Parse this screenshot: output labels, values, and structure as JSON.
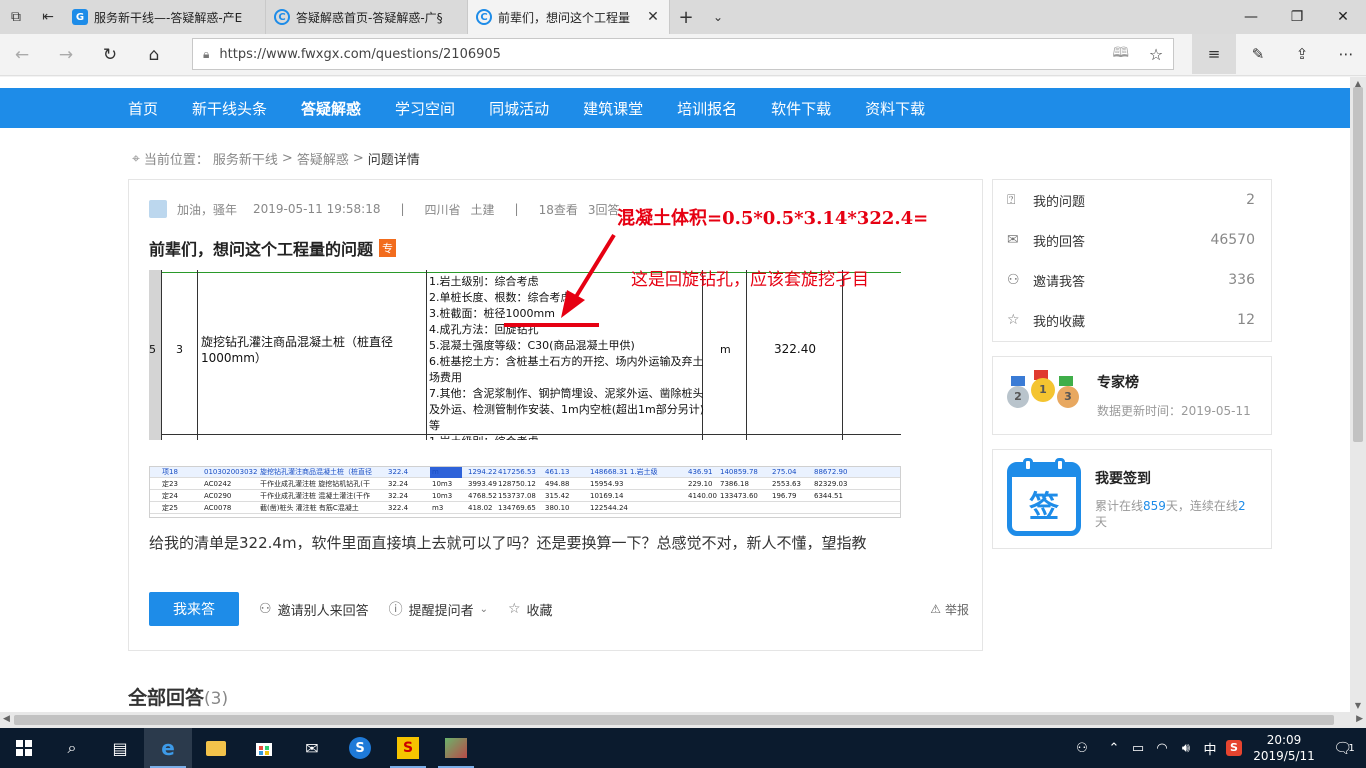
{
  "browser": {
    "tabs": [
      {
        "title": "服务新干线—-答疑解惑-产E",
        "active": false
      },
      {
        "title": "答疑解惑首页-答疑解惑-广§",
        "active": false
      },
      {
        "title": "前辈们，想问这个工程量",
        "active": true
      }
    ],
    "url": "https://www.fwxgx.com/questions/2106905"
  },
  "site_nav": [
    "首页",
    "新干线头条",
    "答疑解惑",
    "学习空间",
    "同城活动",
    "建筑课堂",
    "培训报名",
    "软件下载",
    "资料下载"
  ],
  "site_nav_current": "答疑解惑",
  "breadcrumb": {
    "prefix": "当前位置：",
    "l1": "服务新干线",
    "sep": ">",
    "l2": "答疑解惑",
    "l3": "问题详情"
  },
  "question": {
    "author": "加油，骚年",
    "date": "2019-05-11 19:58:18",
    "sep": "|",
    "region": "四川省",
    "major": "土建",
    "views": "18查看",
    "answers": "3回答",
    "title": "前辈们，想问这个工程量的问题",
    "tag": "专",
    "body": "给我的清单是322.4m，软件里面直接填上去就可以了吗？还是要换算一下？总感觉不对，新人不懂，望指教"
  },
  "annotations": {
    "line1": "混凝土体积=0.5*0.5*3.14*322.4=",
    "line2": "这是回旋钻孔，应该套旋挖孑目"
  },
  "table_image": {
    "left_num": "5",
    "seq": "3",
    "name": "旋挖钻孔灌注商品混凝土桩（桩直径1000mm）",
    "spec": "1.岩土级别：综合考虑\n2.单桩长度、根数：综合考虑\n3.桩截面：桩径1000mm\n4.成孔方法：回旋钻孔\n5.混凝土强度等级：C30(商品混凝土甲供)\n6.桩基挖土方：含桩基土石方的开挖、场内外运输及弃土场费用\n7.其他：含泥浆制作、钢护筒埋设、泥浆外运、凿除桩头及外运、检测管制作安装、1m内空桩(超出1m部分另计)等\n1.岩土级别：综合考虑",
    "unit": "m",
    "qty": "322.40"
  },
  "software_image": {
    "rows": [
      [
        "项18",
        "010302003032",
        "旋挖钻孔灌注商品混凝土桩（桩直径",
        "322.4",
        "m",
        "1294.22",
        "417256.53",
        "461.13",
        "148668.31",
        "1.岩土级",
        "436.91",
        "140859.78",
        "275.04",
        "88672.90"
      ],
      [
        "定23",
        "AC0242",
        "干作业成孔灌注桩 旋挖钻机钻孔(干",
        "32.24",
        "10m3",
        "3993.49",
        "128750.12",
        "494.88",
        "15954.93",
        "",
        "229.10",
        "7386.18",
        "2553.63",
        "82329.03"
      ],
      [
        "定24",
        "AC0290",
        "干作业成孔灌注桩 混凝土灌注(干作",
        "32.24",
        "10m3",
        "4768.52",
        "153737.08",
        "315.42",
        "10169.14",
        "",
        "4140.00",
        "133473.60",
        "196.79",
        "6344.51"
      ],
      [
        "定25",
        "AC0078",
        "截(凿)桩头 灌注桩 有筋C混凝土",
        "322.4",
        "m3",
        "418.02",
        "134769.65",
        "380.10",
        "122544.24",
        "",
        "",
        "",
        "",
        ""
      ]
    ]
  },
  "actions": {
    "answer": "我来答",
    "invite": "邀请别人来回答",
    "remind": "提醒提问者",
    "collect": "收藏",
    "report": "举报"
  },
  "all_answers": {
    "label": "全部回答",
    "count": "(3)"
  },
  "sidebar": {
    "items": [
      {
        "label": "我的问题",
        "count": "2",
        "icon": "question-doc-icon"
      },
      {
        "label": "我的回答",
        "count": "46570",
        "icon": "chat-bubble-icon"
      },
      {
        "label": "邀请我答",
        "count": "336",
        "icon": "user-icon"
      },
      {
        "label": "我的收藏",
        "count": "12",
        "icon": "star-icon"
      }
    ],
    "experts": {
      "title": "专家榜",
      "updated": "数据更新时间：2019-05-11",
      "medals": [
        "2",
        "1",
        "3"
      ]
    },
    "checkin": {
      "title": "我要签到",
      "icon_char": "签",
      "p1": "累计在线",
      "days": "859",
      "p2": "天，连续在线",
      "cont": "2",
      "p3": "天"
    }
  },
  "taskbar": {
    "time": "20:09",
    "date": "2019/5/11",
    "ime": "中",
    "notification_count": "1"
  }
}
